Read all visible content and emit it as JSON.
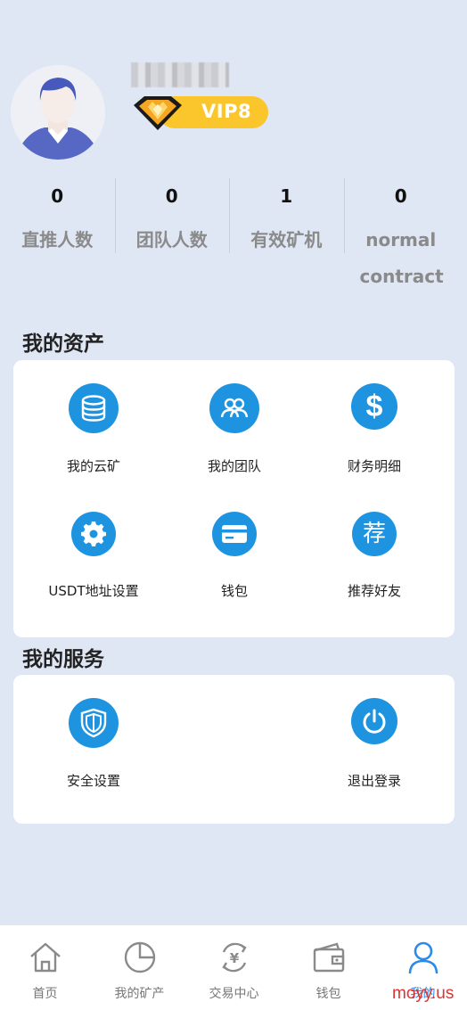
{
  "profile": {
    "vip_label": "VIP8"
  },
  "stats": [
    {
      "value": "0",
      "label": "直推人数"
    },
    {
      "value": "0",
      "label": "团队人数"
    },
    {
      "value": "1",
      "label": "有效矿机"
    },
    {
      "value": "0",
      "label": "normal contract"
    }
  ],
  "assets": {
    "title": "我的资产",
    "items": [
      {
        "label": "我的云矿",
        "icon": "database-icon"
      },
      {
        "label": "我的团队",
        "icon": "team-icon"
      },
      {
        "label": "财务明细",
        "icon": "dollar-icon"
      },
      {
        "label": "USDT地址设置",
        "icon": "gear-icon"
      },
      {
        "label": "钱包",
        "icon": "card-icon"
      },
      {
        "label": "推荐好友",
        "icon": "recommend-icon",
        "glyph": "荐"
      }
    ]
  },
  "services": {
    "title": "我的服务",
    "items": [
      {
        "label": "安全设置",
        "icon": "shield-icon"
      },
      {
        "label": "退出登录",
        "icon": "power-icon"
      }
    ]
  },
  "tabbar": {
    "tabs": [
      {
        "label": "首页",
        "icon": "home-icon"
      },
      {
        "label": "我的矿产",
        "icon": "pie-chart-icon"
      },
      {
        "label": "交易中心",
        "icon": "exchange-icon"
      },
      {
        "label": "钱包",
        "icon": "wallet-icon"
      },
      {
        "label": "我的",
        "icon": "user-icon",
        "active": true
      }
    ]
  },
  "watermark": "moyy.us",
  "colors": {
    "background": "#dfe6f4",
    "accent": "#1e94e0",
    "vip": "#fbc52c",
    "active_tab": "#2a8ae8"
  }
}
